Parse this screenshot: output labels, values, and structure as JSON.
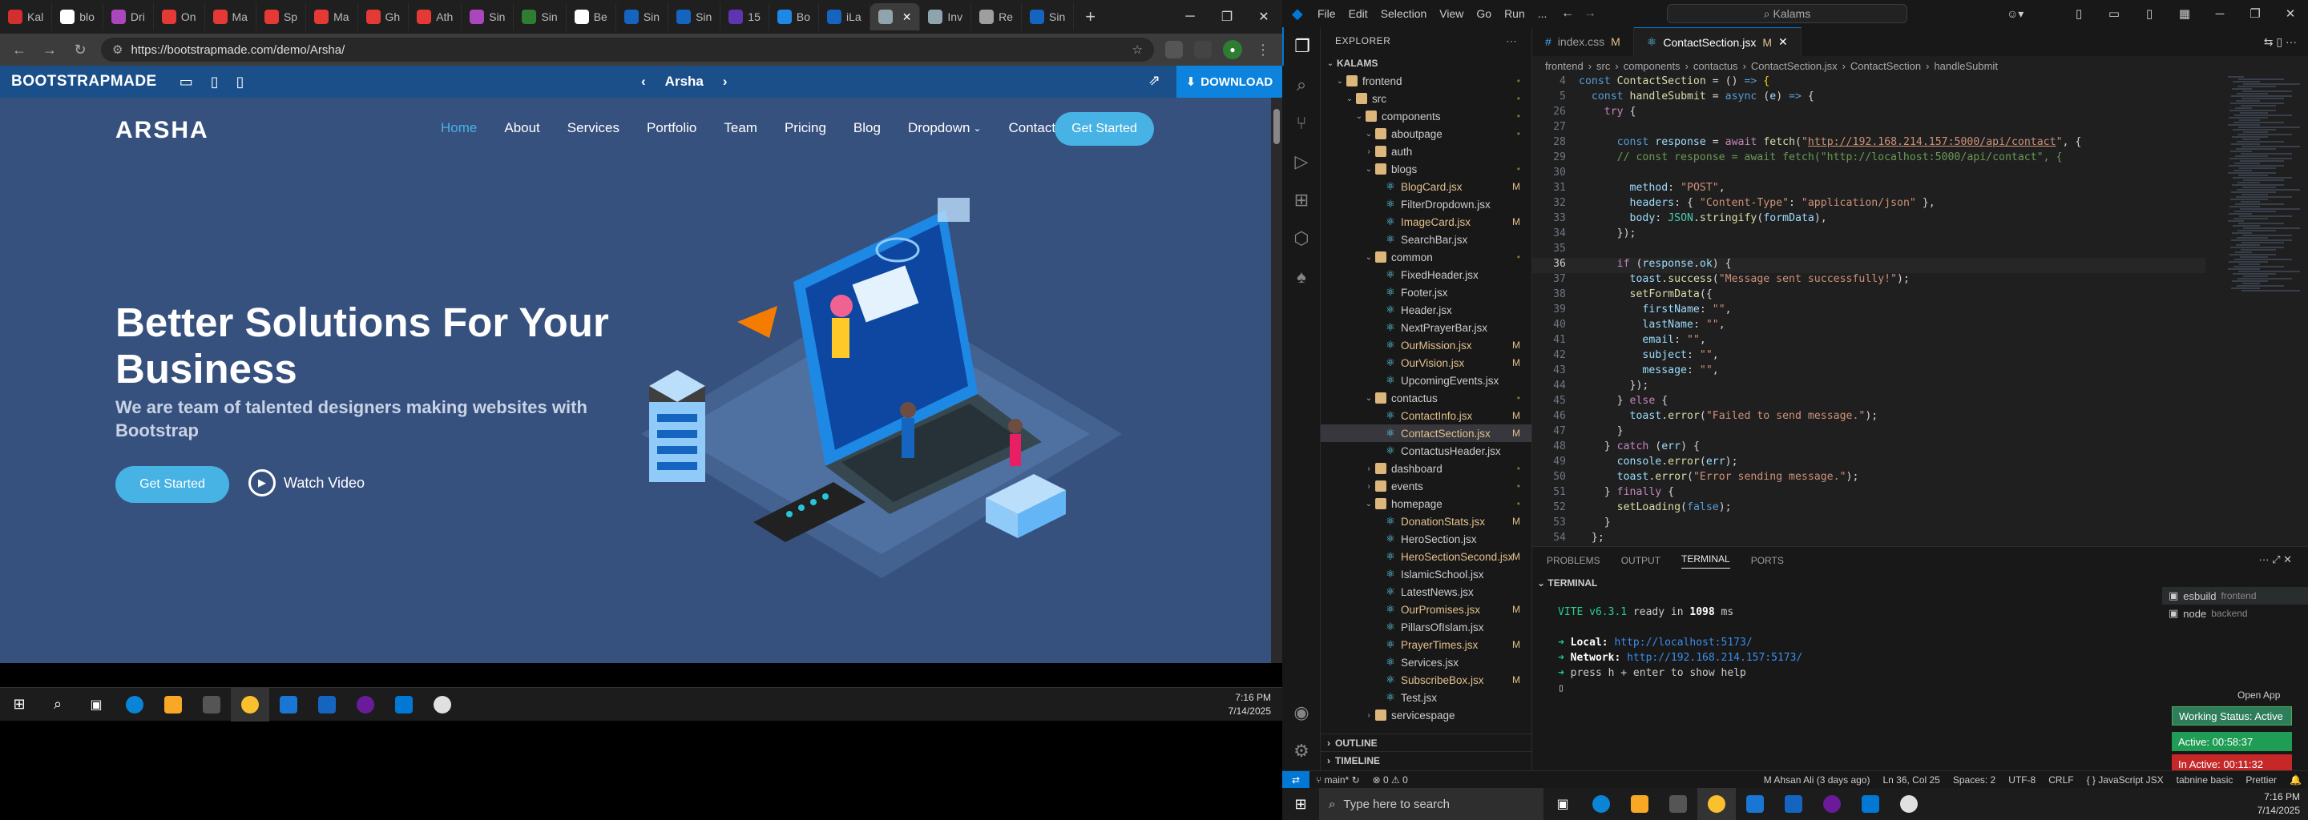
{
  "browser": {
    "tabs": [
      {
        "label": "Kal",
        "color": "#d32f2f"
      },
      {
        "label": "blo",
        "color": "#ffffff"
      },
      {
        "label": "Dri",
        "color": "#ab47bc"
      },
      {
        "label": "On",
        "color": "#e53935"
      },
      {
        "label": "Ma",
        "color": "#e53935"
      },
      {
        "label": "Sp",
        "color": "#e53935"
      },
      {
        "label": "Ma",
        "color": "#e53935"
      },
      {
        "label": "Gh",
        "color": "#e53935"
      },
      {
        "label": "Ath",
        "color": "#e53935"
      },
      {
        "label": "Sin",
        "color": "#ab47bc"
      },
      {
        "label": "Sin",
        "color": "#2e7d32"
      },
      {
        "label": "Be",
        "color": "#ffffff"
      },
      {
        "label": "Sin",
        "color": "#1565c0"
      },
      {
        "label": "Sin",
        "color": "#1565c0"
      },
      {
        "label": "15",
        "color": "#5e35b1"
      },
      {
        "label": "Bo",
        "color": "#1e88e5"
      },
      {
        "label": "iLa",
        "color": "#1565c0"
      },
      {
        "label": "",
        "color": "#90a4ae"
      },
      {
        "label": "Inv",
        "color": "#90a4ae"
      },
      {
        "label": "Re",
        "color": "#9e9e9e"
      },
      {
        "label": "Sin",
        "color": "#1565c0"
      }
    ],
    "new_tab": "+",
    "url": "https://bootstrapmade.com/demo/Arsha/"
  },
  "preview_bar": {
    "logo": "BOOTSTRAPMADE",
    "template_name": "Arsha",
    "download": "DOWNLOAD"
  },
  "site": {
    "logo": "ARSHA",
    "nav": [
      "Home",
      "About",
      "Services",
      "Portfolio",
      "Team",
      "Pricing",
      "Blog",
      "Dropdown",
      "Contact"
    ],
    "cta": "Get Started",
    "hero_title": "Better Solutions For Your Business",
    "hero_subtitle": "We are team of talented designers making websites with Bootstrap",
    "hero_button": "Get Started",
    "watch_video": "Watch Video"
  },
  "taskbar_left": {
    "time": "7:16 PM",
    "date": "7/14/2025"
  },
  "vscode": {
    "menu": [
      "File",
      "Edit",
      "Selection",
      "View",
      "Go",
      "Run",
      "..."
    ],
    "search": "Kalams",
    "explorer_title": "EXPLORER",
    "tree": [
      {
        "d": 0,
        "type": "root",
        "name": "KALAMS"
      },
      {
        "d": 1,
        "type": "fold",
        "name": "frontend",
        "badge": "•"
      },
      {
        "d": 2,
        "type": "fold",
        "name": "src",
        "badge": "•"
      },
      {
        "d": 3,
        "type": "fold",
        "name": "components",
        "badge": "•"
      },
      {
        "d": 4,
        "type": "fold",
        "name": "aboutpage",
        "badge": "•"
      },
      {
        "d": 4,
        "type": "foldc",
        "name": "auth",
        "badge": ""
      },
      {
        "d": 4,
        "type": "fold",
        "name": "blogs",
        "badge": "•"
      },
      {
        "d": 5,
        "type": "file",
        "name": "BlogCard.jsx",
        "badge": "M",
        "m": true
      },
      {
        "d": 5,
        "type": "file",
        "name": "FilterDropdown.jsx",
        "badge": ""
      },
      {
        "d": 5,
        "type": "file",
        "name": "ImageCard.jsx",
        "badge": "M",
        "m": true
      },
      {
        "d": 5,
        "type": "file",
        "name": "SearchBar.jsx",
        "badge": ""
      },
      {
        "d": 4,
        "type": "fold",
        "name": "common",
        "badge": "•"
      },
      {
        "d": 5,
        "type": "file",
        "name": "FixedHeader.jsx",
        "badge": ""
      },
      {
        "d": 5,
        "type": "file",
        "name": "Footer.jsx",
        "badge": ""
      },
      {
        "d": 5,
        "type": "file",
        "name": "Header.jsx",
        "badge": ""
      },
      {
        "d": 5,
        "type": "file",
        "name": "NextPrayerBar.jsx",
        "badge": ""
      },
      {
        "d": 5,
        "type": "file",
        "name": "OurMission.jsx",
        "badge": "M",
        "m": true
      },
      {
        "d": 5,
        "type": "file",
        "name": "OurVision.jsx",
        "badge": "M",
        "m": true
      },
      {
        "d": 5,
        "type": "file",
        "name": "UpcomingEvents.jsx",
        "badge": ""
      },
      {
        "d": 4,
        "type": "fold",
        "name": "contactus",
        "badge": "•"
      },
      {
        "d": 5,
        "type": "file",
        "name": "ContactInfo.jsx",
        "badge": "M",
        "m": true
      },
      {
        "d": 5,
        "type": "file",
        "name": "ContactSection.jsx",
        "badge": "M",
        "m": true,
        "sel": true
      },
      {
        "d": 5,
        "type": "file",
        "name": "ContactusHeader.jsx",
        "badge": ""
      },
      {
        "d": 4,
        "type": "foldc",
        "name": "dashboard",
        "badge": "•"
      },
      {
        "d": 4,
        "type": "foldc",
        "name": "events",
        "badge": "•"
      },
      {
        "d": 4,
        "type": "fold",
        "name": "homepage",
        "badge": "•"
      },
      {
        "d": 5,
        "type": "file",
        "name": "DonationStats.jsx",
        "badge": "M",
        "m": true
      },
      {
        "d": 5,
        "type": "file",
        "name": "HeroSection.jsx",
        "badge": ""
      },
      {
        "d": 5,
        "type": "file",
        "name": "HeroSectionSecond.jsx",
        "badge": "M",
        "m": true
      },
      {
        "d": 5,
        "type": "file",
        "name": "IslamicSchool.jsx",
        "badge": ""
      },
      {
        "d": 5,
        "type": "file",
        "name": "LatestNews.jsx",
        "badge": ""
      },
      {
        "d": 5,
        "type": "file",
        "name": "OurPromises.jsx",
        "badge": "M",
        "m": true
      },
      {
        "d": 5,
        "type": "file",
        "name": "PillarsOfIslam.jsx",
        "badge": ""
      },
      {
        "d": 5,
        "type": "file",
        "name": "PrayerTimes.jsx",
        "badge": "M",
        "m": true
      },
      {
        "d": 5,
        "type": "file",
        "name": "Services.jsx",
        "badge": ""
      },
      {
        "d": 5,
        "type": "file",
        "name": "SubscribeBox.jsx",
        "badge": "M",
        "m": true
      },
      {
        "d": 5,
        "type": "file",
        "name": "Test.jsx",
        "badge": ""
      },
      {
        "d": 4,
        "type": "foldc",
        "name": "servicespage",
        "badge": ""
      }
    ],
    "outline": "OUTLINE",
    "timeline": "TIMELINE",
    "tabs": [
      {
        "name": "index.css",
        "badge": "M"
      },
      {
        "name": "ContactSection.jsx",
        "badge": "M"
      }
    ],
    "breadcrumb": [
      "frontend",
      "src",
      "components",
      "contactus",
      "ContactSection.jsx",
      "ContactSection",
      "handleSubmit"
    ],
    "code_start": 4,
    "current_line": 36,
    "panel_tabs": [
      "PROBLEMS",
      "OUTPUT",
      "TERMINAL",
      "PORTS"
    ],
    "terminal_title": "TERMINAL",
    "terminal": {
      "vite": "VITE v6.3.1",
      "ready": "ready in",
      "ms": "1098",
      "ms_unit": "ms",
      "local_label": "Local:",
      "local_url": "http://localhost:5173/",
      "network_label": "Network:",
      "network_url": "http://192.168.214.157:5173/",
      "help": "press h + enter to show help"
    },
    "terminals": [
      {
        "name": "esbuild",
        "desc": "frontend"
      },
      {
        "name": "node",
        "desc": "backend"
      }
    ],
    "open_app": "Open App",
    "tracker": [
      {
        "label": "Working Status: Active",
        "color": "#2e7d5b"
      },
      {
        "label": "Active: 00:58:37",
        "color": "#1f9d55"
      },
      {
        "label": "In Active: 00:11:32",
        "color": "#c62828"
      }
    ],
    "status": {
      "branch": "main*",
      "problems": "⊗ 0 ⚠ 0",
      "blame": "M Ahsan Ali (3 days ago)",
      "position": "Ln 36, Col 25",
      "spaces": "Spaces: 2",
      "encoding": "UTF-8",
      "eol": "CRLF",
      "language": "JavaScript JSX",
      "tabnine": "tabnine basic",
      "prettier": "Prettier"
    }
  },
  "taskbar_right": {
    "search": "Type here to search",
    "time": "7:16 PM",
    "date": "7/14/2025"
  }
}
